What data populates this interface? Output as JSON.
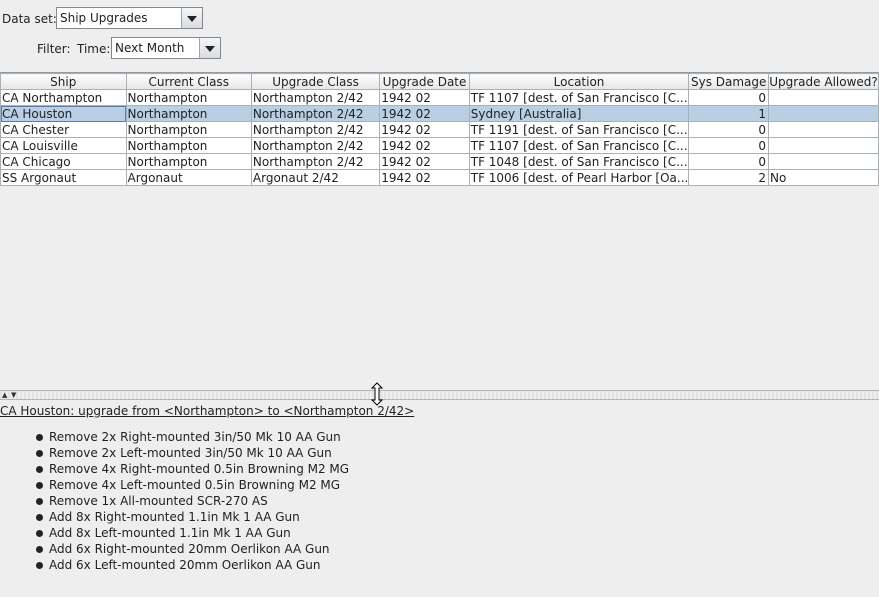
{
  "toolbar": {
    "dataset_label": "Data set:",
    "dataset_value": "Ship Upgrades",
    "filter_label": "Filter:",
    "time_label": "Time:",
    "time_value": "Next Month"
  },
  "table": {
    "columns": [
      "Ship",
      "Current Class",
      "Upgrade Class",
      "Upgrade Date",
      "Location",
      "Sys Damage",
      "Upgrade Allowed?"
    ],
    "rows": [
      [
        "CA Northampton",
        "Northampton",
        "Northampton 2/42",
        "1942 02",
        "TF 1107 [dest. of San Francisco [C...",
        "0",
        ""
      ],
      [
        "CA Houston",
        "Northampton",
        "Northampton 2/42",
        "1942 02",
        "Sydney [Australia]",
        "1",
        ""
      ],
      [
        "CA Chester",
        "Northampton",
        "Northampton 2/42",
        "1942 02",
        "TF 1191 [dest. of San Francisco [C...",
        "0",
        ""
      ],
      [
        "CA Louisville",
        "Northampton",
        "Northampton 2/42",
        "1942 02",
        "TF 1107 [dest. of San Francisco [C...",
        "0",
        ""
      ],
      [
        "CA Chicago",
        "Northampton",
        "Northampton 2/42",
        "1942 02",
        "TF 1048 [dest. of San Francisco [C...",
        "0",
        ""
      ],
      [
        "SS Argonaut",
        "Argonaut",
        "Argonaut 2/42",
        "1942 02",
        "TF 1006 [dest. of Pearl Harbor [Oa...",
        "2",
        "No"
      ]
    ],
    "selected_row": 1
  },
  "detail": {
    "title": "CA Houston: upgrade from <Northampton> to <Northampton 2/42>",
    "items": [
      "Remove 2x Right-mounted 3in/50 Mk 10 AA Gun",
      "Remove 2x Left-mounted 3in/50 Mk 10 AA Gun",
      "Remove 4x Right-mounted 0.5in Browning M2 MG",
      "Remove 4x Left-mounted 0.5in Browning M2 MG",
      "Remove 1x All-mounted SCR-270 AS",
      "Add 8x Right-mounted 1.1in Mk 1 AA Gun",
      "Add 8x Left-mounted 1.1in Mk 1 AA Gun",
      "Add 6x Right-mounted 20mm Oerlikon AA Gun",
      "Add 6x Left-mounted 20mm Oerlikon AA Gun"
    ]
  },
  "colors": {
    "selection": "#b8cfe5",
    "background": "#eeeeee"
  }
}
